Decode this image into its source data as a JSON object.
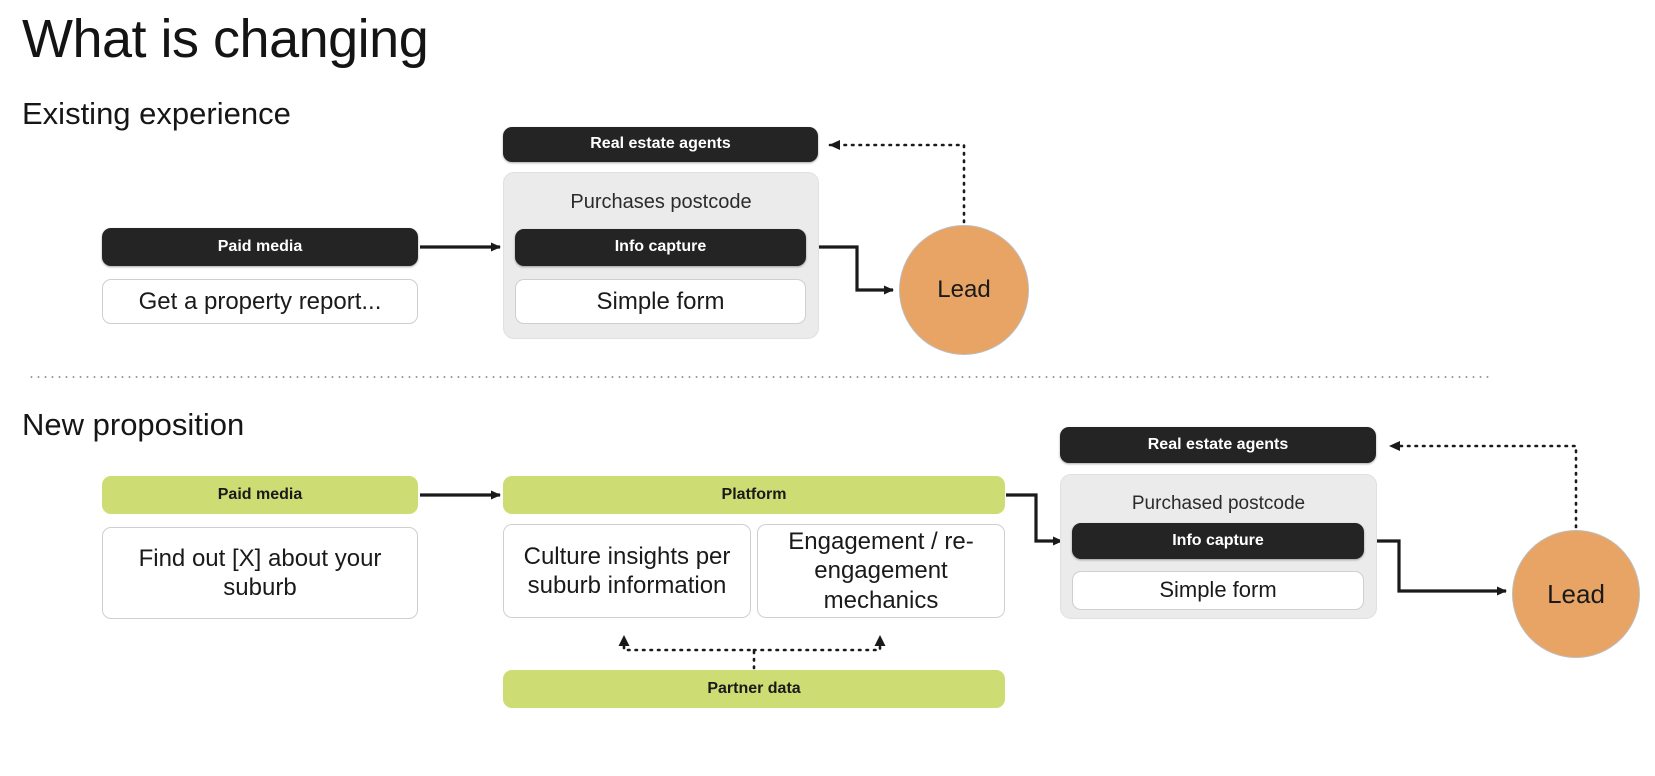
{
  "page": {
    "title": "What is changing"
  },
  "colors": {
    "dark": "#242424",
    "green": "#cddc73",
    "orange": "#e7a465",
    "panel_grey": "#ebebeb",
    "white": "#ffffff",
    "text": "#1a1a1a"
  },
  "sections": {
    "existing": {
      "heading": "Existing experience",
      "nodes": {
        "paid_media": "Paid media",
        "paid_media_sub": "Get a property report...",
        "real_estate_agents": "Real estate agents",
        "panel_label": "Purchases postcode",
        "info_capture": "Info capture",
        "simple_form": "Simple form",
        "lead": "Lead"
      }
    },
    "new": {
      "heading": "New proposition",
      "nodes": {
        "paid_media": "Paid media",
        "paid_media_sub": "Find out [X] about your suburb",
        "platform": "Platform",
        "culture_insights": "Culture insights per suburb information",
        "engagement": "Engagement / re-engagement mechanics",
        "partner_data": "Partner data",
        "real_estate_agents": "Real estate agents",
        "panel_label": "Purchased postcode",
        "info_capture": "Info capture",
        "simple_form": "Simple form",
        "lead": "Lead"
      }
    }
  }
}
